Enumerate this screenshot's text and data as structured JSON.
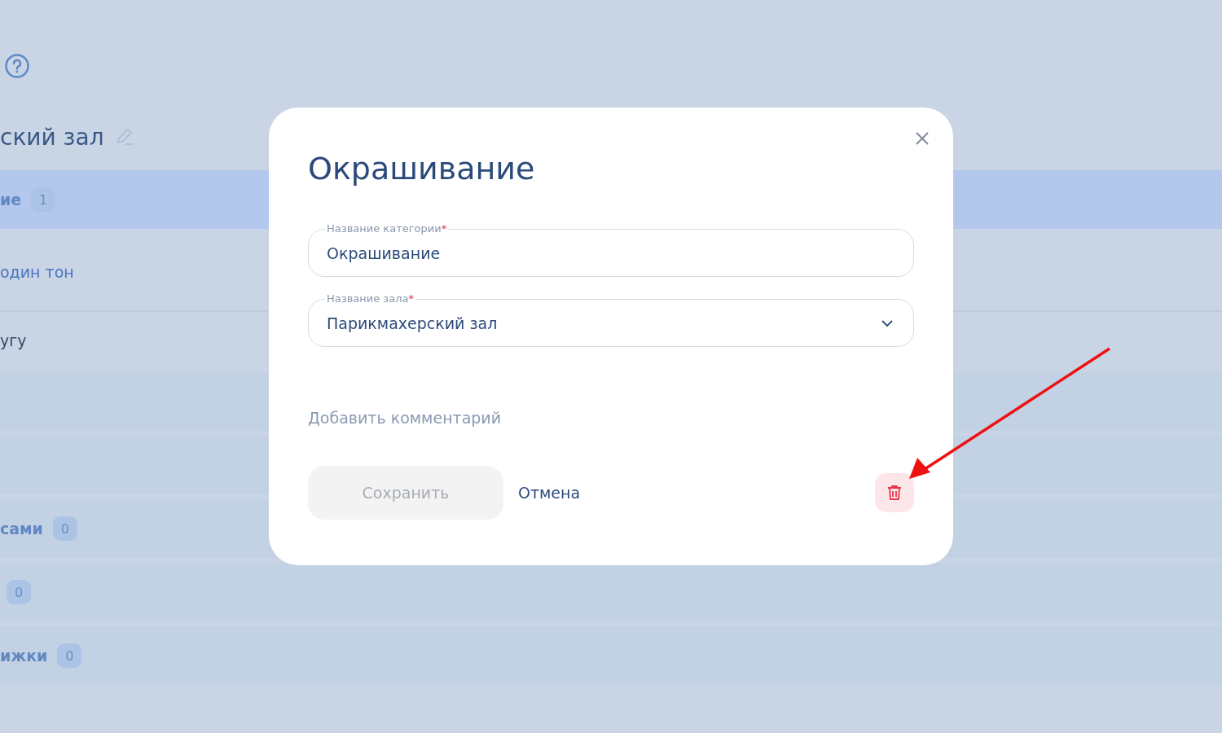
{
  "background": {
    "heading": "ский зал",
    "rows": [
      {
        "kind": "category",
        "label": "ие",
        "badge": "1",
        "selected": true
      },
      {
        "kind": "service",
        "label": "один тон"
      },
      {
        "kind": "add",
        "label": "угу"
      },
      {
        "kind": "category",
        "selected": false
      },
      {
        "kind": "category",
        "selected": false
      },
      {
        "kind": "category",
        "label": "сами",
        "badge": "0",
        "selected": false
      },
      {
        "kind": "category",
        "badge": "0",
        "selected": false
      },
      {
        "kind": "category",
        "label": "ижки",
        "badge": "0",
        "selected": false
      }
    ]
  },
  "dialog": {
    "title": "Окрашивание",
    "fields": [
      {
        "kind": "text",
        "label": "Название категории",
        "required_mark": "*",
        "value": "Окрашивание"
      },
      {
        "kind": "select",
        "label": "Название зала",
        "required_mark": "*",
        "value": "Парикмахерский зал"
      }
    ],
    "comment_link": "Добавить комментарий",
    "save_button": {
      "label": "Сохранить",
      "disabled": true
    },
    "cancel_button": "Отмена"
  }
}
